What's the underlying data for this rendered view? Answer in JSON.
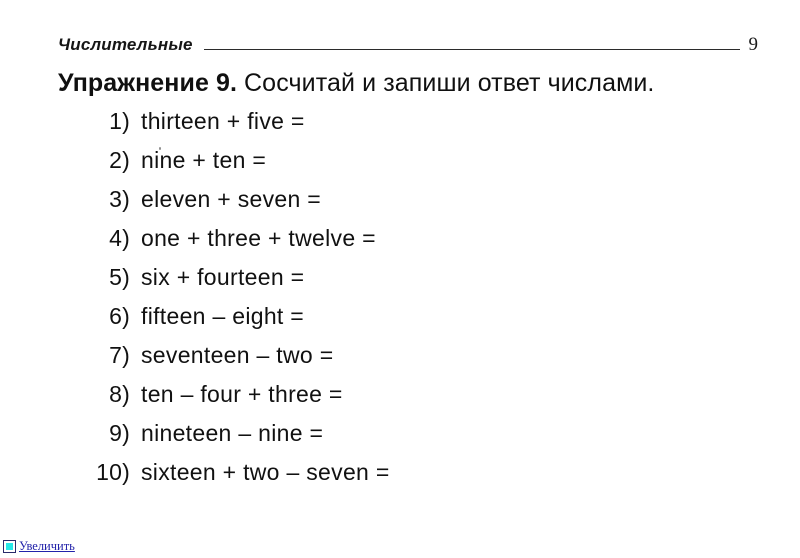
{
  "page": {
    "header": {
      "section_title": "Числительные",
      "page_number": "9",
      "rule_icon": "horizontal-rule"
    },
    "exercise": {
      "label": "Упражнение 9.",
      "instruction": "Сосчитай и запиши ответ числами."
    },
    "tasks": [
      {
        "marker": "1)",
        "expression": "thirteen + five =",
        "terms": [
          "thirteen",
          "five"
        ],
        "operators": [
          "+"
        ],
        "result_blank": true
      },
      {
        "marker": "2)",
        "expression": "nine + ten =",
        "terms": [
          "nine",
          "ten"
        ],
        "operators": [
          "+"
        ],
        "result_blank": true
      },
      {
        "marker": "3)",
        "expression": "eleven + seven =",
        "terms": [
          "eleven",
          "seven"
        ],
        "operators": [
          "+"
        ],
        "result_blank": true
      },
      {
        "marker": "4)",
        "expression": "one + three + twelve =",
        "terms": [
          "one",
          "three",
          "twelve"
        ],
        "operators": [
          "+",
          "+"
        ],
        "result_blank": true
      },
      {
        "marker": "5)",
        "expression": "six + fourteen =",
        "terms": [
          "six",
          "fourteen"
        ],
        "operators": [
          "+"
        ],
        "result_blank": true
      },
      {
        "marker": "6)",
        "expression": "fifteen – eight =",
        "terms": [
          "fifteen",
          "eight"
        ],
        "operators": [
          "–"
        ],
        "result_blank": true
      },
      {
        "marker": "7)",
        "expression": "seventeen – two =",
        "terms": [
          "seventeen",
          "two"
        ],
        "operators": [
          "–"
        ],
        "result_blank": true
      },
      {
        "marker": "8)",
        "expression": "ten – four + three =",
        "terms": [
          "ten",
          "four",
          "three"
        ],
        "operators": [
          "–",
          "+"
        ],
        "result_blank": true
      },
      {
        "marker": "9)",
        "expression": "nineteen – nine =",
        "terms": [
          "nineteen",
          "nine"
        ],
        "operators": [
          "–"
        ],
        "result_blank": true
      },
      {
        "marker": "10)",
        "expression": "sixteen + two – seven =",
        "terms": [
          "sixteen",
          "two",
          "seven"
        ],
        "operators": [
          "+",
          "–"
        ],
        "result_blank": true
      }
    ],
    "zoom_link": {
      "label": "Увеличить",
      "icon": "broken-image-icon",
      "link_color": "#2222aa",
      "icon_fill_color": "#27e8e8"
    },
    "colors": {
      "background": "#ffffff",
      "text": "#111111",
      "rule": "#2b2b2b"
    }
  }
}
